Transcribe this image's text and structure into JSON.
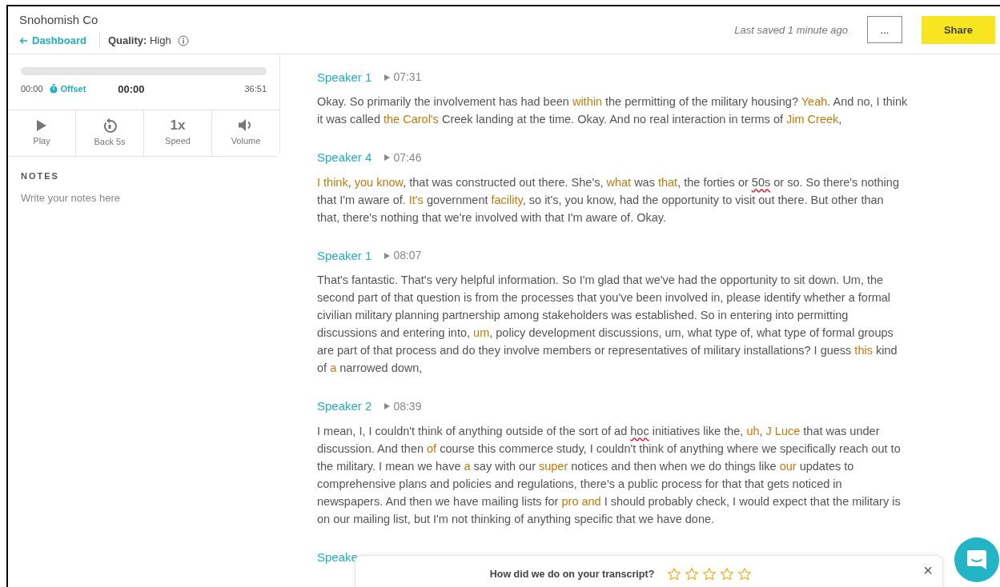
{
  "header": {
    "title": "Snohomish Co",
    "back_link": "Dashboard",
    "quality_label": "Quality:",
    "quality_value": "High",
    "last_saved": "Last saved 1 minute ago",
    "more_button": "...",
    "share_button": "Share"
  },
  "player": {
    "level": 0,
    "start_time": "00:00",
    "offset_link": "Offset",
    "current_time": "00:00",
    "end_time": "36:51",
    "controls": [
      {
        "kind": "play",
        "label": "Play"
      },
      {
        "kind": "back",
        "label": "Back 5s"
      },
      {
        "kind": "speed",
        "value": "1x",
        "label": "Speed"
      },
      {
        "kind": "volume",
        "label": "Volume"
      }
    ]
  },
  "notes": {
    "heading": "NOTES",
    "placeholder": "Write your notes here"
  },
  "transcript": [
    {
      "speaker": "Speaker 1",
      "time": "07:31",
      "parts": [
        {
          "kind": "plain",
          "text": "Okay. So primarily the involvement has had been "
        },
        {
          "kind": "flagged",
          "text": "within"
        },
        {
          "kind": "plain",
          "text": " the permitting of the military housing? "
        },
        {
          "kind": "flagged",
          "text": "Yeah"
        },
        {
          "kind": "plain",
          "text": ". And no, I think it was called "
        },
        {
          "kind": "flagged",
          "text": "the Carol's"
        },
        {
          "kind": "plain",
          "text": " Creek landing at the time. Okay. And no real interaction in terms of "
        },
        {
          "kind": "flagged",
          "text": "Jim Creek"
        },
        {
          "kind": "plain",
          "text": ","
        }
      ]
    },
    {
      "speaker": "Speaker 4",
      "time": "07:46",
      "parts": [
        {
          "kind": "flagged",
          "text": "I think"
        },
        {
          "kind": "plain",
          "text": ", "
        },
        {
          "kind": "flagged",
          "text": "you know"
        },
        {
          "kind": "plain",
          "text": ", that was constructed out there. She's, "
        },
        {
          "kind": "flagged",
          "text": "what"
        },
        {
          "kind": "plain",
          "text": " was "
        },
        {
          "kind": "flagged",
          "text": "that"
        },
        {
          "kind": "plain",
          "text": ", the forties or "
        },
        {
          "kind": "misspelled",
          "text": "50s"
        },
        {
          "kind": "plain",
          "text": " or so. So there's nothing that I'm aware of. "
        },
        {
          "kind": "flagged",
          "text": "It's"
        },
        {
          "kind": "plain",
          "text": " government "
        },
        {
          "kind": "flagged",
          "text": "facility"
        },
        {
          "kind": "plain",
          "text": ", so it's, you know, had the opportunity to visit out there. But other than that, there's nothing that we're involved with that I'm aware of. Okay."
        }
      ]
    },
    {
      "speaker": "Speaker 1",
      "time": "08:07",
      "parts": [
        {
          "kind": "plain",
          "text": "That's fantastic. That's very helpful information. So I'm glad that we've had the opportunity to sit down. Um, the second part of that question is from the processes that you've been involved in, please identify whether a formal civilian military planning partnership among stakeholders was established. So in entering into permitting discussions and entering into, "
        },
        {
          "kind": "flagged",
          "text": "um"
        },
        {
          "kind": "plain",
          "text": ", policy development discussions, um, what type of, what type of formal groups are part of that process and do they involve members or representatives of military installations? I guess "
        },
        {
          "kind": "flagged",
          "text": "this"
        },
        {
          "kind": "plain",
          "text": " kind of "
        },
        {
          "kind": "flagged",
          "text": "a"
        },
        {
          "kind": "plain",
          "text": " narrowed down,"
        }
      ]
    },
    {
      "speaker": "Speaker 2",
      "time": "08:39",
      "parts": [
        {
          "kind": "plain",
          "text": "I mean, I, I couldn't think of anything outside of the sort of ad "
        },
        {
          "kind": "misspelled",
          "text": "hoc"
        },
        {
          "kind": "plain",
          "text": " initiatives like the, "
        },
        {
          "kind": "flagged",
          "text": "uh"
        },
        {
          "kind": "plain",
          "text": ", "
        },
        {
          "kind": "flagged",
          "text": "J Luce"
        },
        {
          "kind": "plain",
          "text": " that was under discussion. And then "
        },
        {
          "kind": "flagged",
          "text": "of"
        },
        {
          "kind": "plain",
          "text": " course this commerce study, I couldn't think of anything where we specifically reach out to the military. I mean we have "
        },
        {
          "kind": "flagged",
          "text": "a"
        },
        {
          "kind": "plain",
          "text": " say with our "
        },
        {
          "kind": "flagged",
          "text": "super"
        },
        {
          "kind": "plain",
          "text": " notices and then when we do things like "
        },
        {
          "kind": "flagged",
          "text": "our"
        },
        {
          "kind": "plain",
          "text": " updates to comprehensive plans and policies and regulations, there's a public process for that that gets noticed in newspapers. And then we have mailing lists for "
        },
        {
          "kind": "flagged",
          "text": "pro and"
        },
        {
          "kind": "plain",
          "text": " I should probably check, I would expect that the military is on our mailing list, but I'm not thinking of anything specific that we have done."
        }
      ]
    },
    {
      "speaker": "Speake"
    }
  ],
  "feedback": {
    "question": "How did we do on your transcript?",
    "stars": 0,
    "close": "×"
  }
}
